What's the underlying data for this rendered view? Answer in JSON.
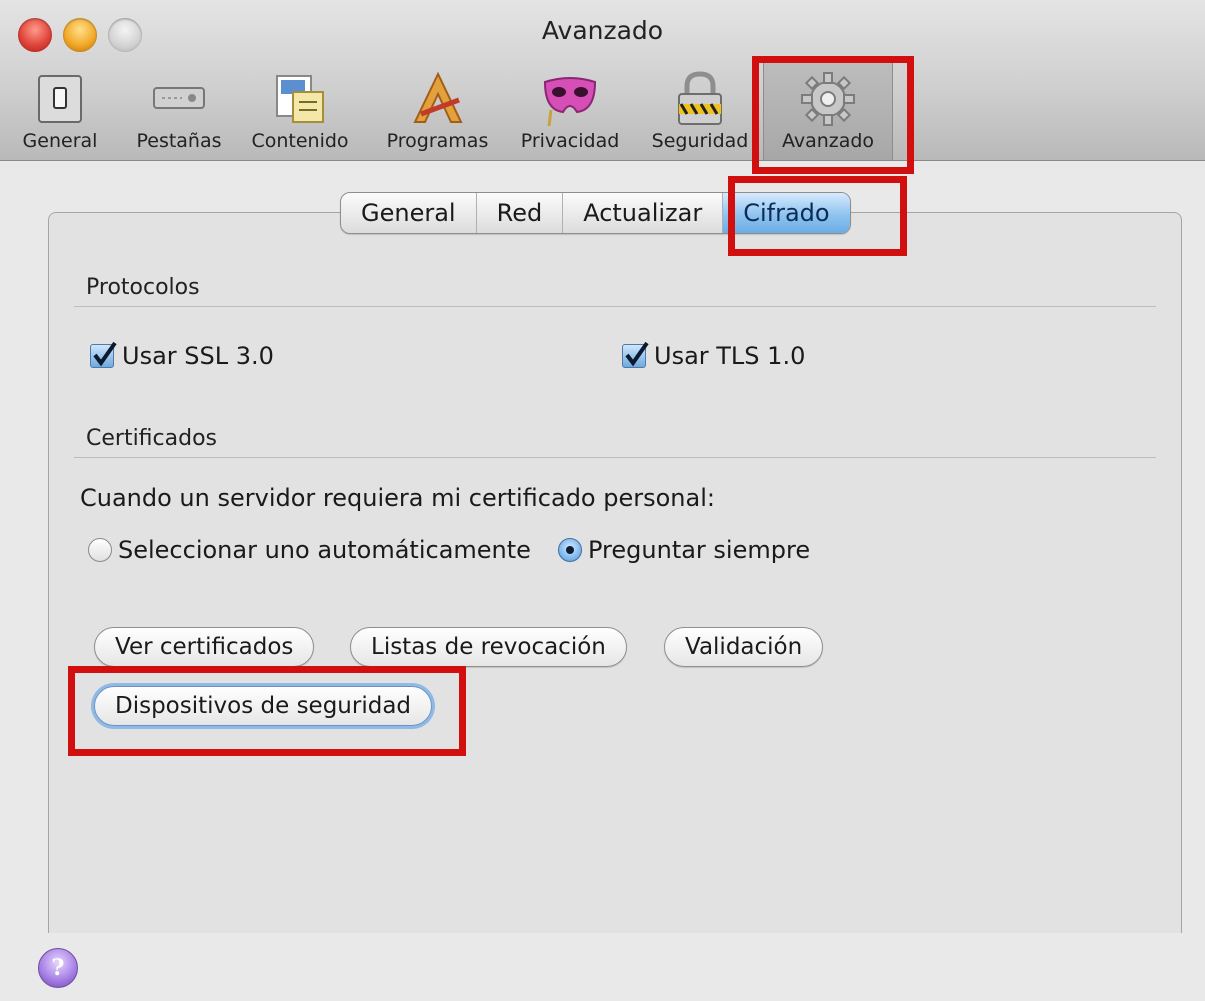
{
  "window": {
    "title": "Avanzado"
  },
  "toolbar": {
    "items": [
      {
        "label": "General",
        "icon": "general-switch-icon"
      },
      {
        "label": "Pestañas",
        "icon": "tabs-icon"
      },
      {
        "label": "Contenido",
        "icon": "content-icon"
      },
      {
        "label": "Programas",
        "icon": "applications-icon"
      },
      {
        "label": "Privacidad",
        "icon": "privacy-mask-icon"
      },
      {
        "label": "Seguridad",
        "icon": "security-lock-icon"
      },
      {
        "label": "Avanzado",
        "icon": "gear-icon",
        "selected": true
      }
    ]
  },
  "tabs": {
    "items": [
      {
        "label": "General"
      },
      {
        "label": "Red"
      },
      {
        "label": "Actualizar"
      },
      {
        "label": "Cifrado",
        "active": true
      }
    ]
  },
  "protocols": {
    "title": "Protocolos",
    "ssl_label": "Usar SSL 3.0",
    "ssl_checked": true,
    "tls_label": "Usar TLS 1.0",
    "tls_checked": true
  },
  "certificates": {
    "title": "Certificados",
    "prompt": "Cuando un servidor requiera mi certificado personal:",
    "radio_auto": "Seleccionar uno automáticamente",
    "radio_ask": "Preguntar siempre",
    "selected": "ask"
  },
  "buttons": {
    "view_certs": "Ver certificados",
    "revocation_lists": "Listas de revocación",
    "validation": "Validación",
    "security_devices": "Dispositivos de seguridad"
  },
  "help": {
    "label": "?"
  },
  "colors": {
    "highlight_red": "#d10f0f",
    "selected_tab_blue": "#8fc3ef"
  }
}
